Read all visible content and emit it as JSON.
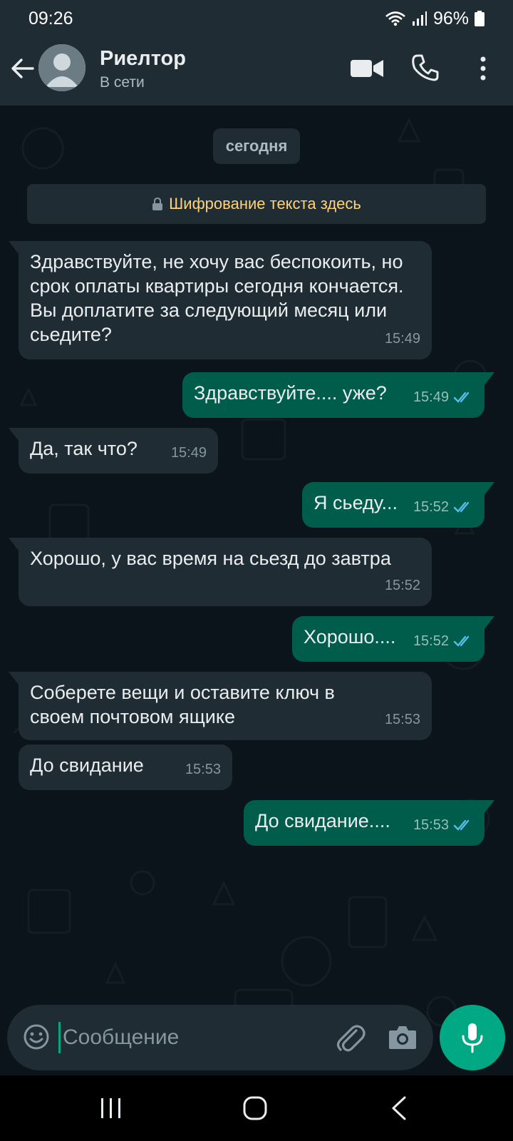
{
  "status_bar": {
    "time": "09:26",
    "battery": "96%"
  },
  "header": {
    "contact_name": "Риелтор",
    "contact_status": "В сети"
  },
  "chat": {
    "date_chip": "сегодня",
    "encryption_notice": "Шифрование текста здесь",
    "messages": [
      {
        "direction": "in",
        "text": "Здравствуйте, не хочу вас беспокоить, но срок оплаты квартиры сегодня кончается. Вы доплатите за следующий месяц или сьедите?",
        "time": "15:49"
      },
      {
        "direction": "out",
        "text": "Здравствуйте.... уже?",
        "time": "15:49",
        "status": "read"
      },
      {
        "direction": "in",
        "text": "Да, так что?",
        "time": "15:49"
      },
      {
        "direction": "out",
        "text": "Я сьеду...",
        "time": "15:52",
        "status": "read"
      },
      {
        "direction": "in",
        "text": "Хорошо, у вас время на сьезд до завтра",
        "time": "15:52"
      },
      {
        "direction": "out",
        "text": "Хорошо....",
        "time": "15:52",
        "status": "read"
      },
      {
        "direction": "in",
        "text": "Соберете вещи и оставите ключ в своем почтовом ящике",
        "time": "15:53"
      },
      {
        "direction": "in",
        "text": "До свидание",
        "time": "15:53"
      },
      {
        "direction": "out",
        "text": "До свидание....",
        "time": "15:53",
        "status": "read"
      }
    ]
  },
  "composer": {
    "placeholder": "Сообщение"
  },
  "colors": {
    "background": "#0b141a",
    "header": "#1f2c34",
    "incoming_bubble": "#202c33",
    "outgoing_bubble": "#005c4b",
    "accent": "#00a884",
    "read_ticks": "#53bdeb",
    "encryption_text": "#ffd279"
  },
  "icons": {
    "header": [
      "back-arrow-icon",
      "avatar",
      "video-call-icon",
      "phone-icon",
      "more-vert-icon"
    ],
    "composer": [
      "emoji-icon",
      "attach-icon",
      "camera-icon",
      "mic-icon"
    ],
    "navbar": [
      "recent-apps-icon",
      "home-icon",
      "back-icon"
    ]
  }
}
